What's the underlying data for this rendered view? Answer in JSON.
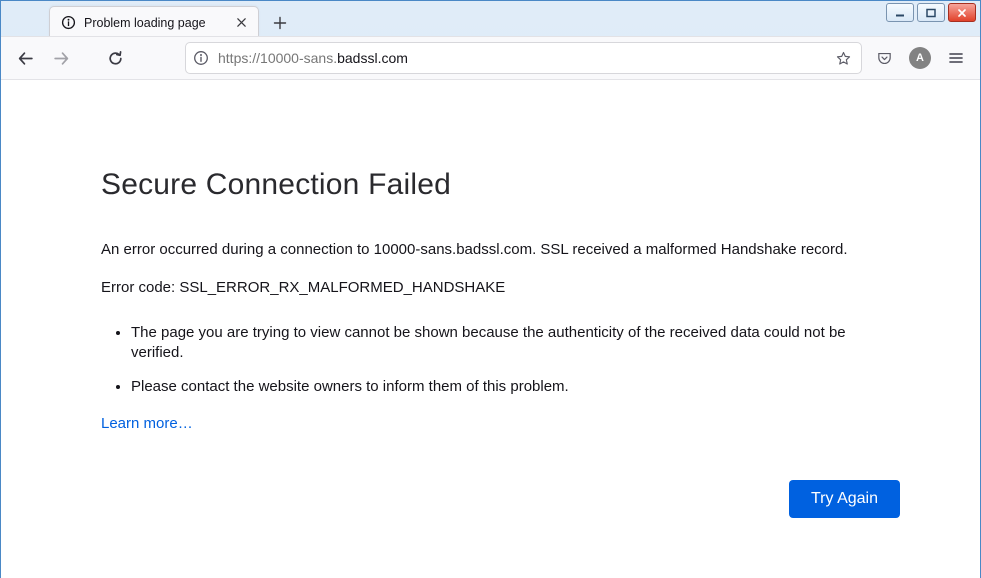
{
  "tab": {
    "title": "Problem loading page"
  },
  "url": {
    "scheme": "https://",
    "sub": "10000-sans.",
    "host": "badssl.com"
  },
  "avatar_initial": "A",
  "error": {
    "title": "Secure Connection Failed",
    "para1": "An error occurred during a connection to 10000-sans.badssl.com. SSL received a malformed Handshake record.",
    "para2": "Error code: SSL_ERROR_RX_MALFORMED_HANDSHAKE",
    "bullet1": "The page you are trying to view cannot be shown because the authenticity of the received data could not be verified.",
    "bullet2": "Please contact the website owners to inform them of this problem.",
    "learn_more": "Learn more…",
    "try_again": "Try Again"
  }
}
